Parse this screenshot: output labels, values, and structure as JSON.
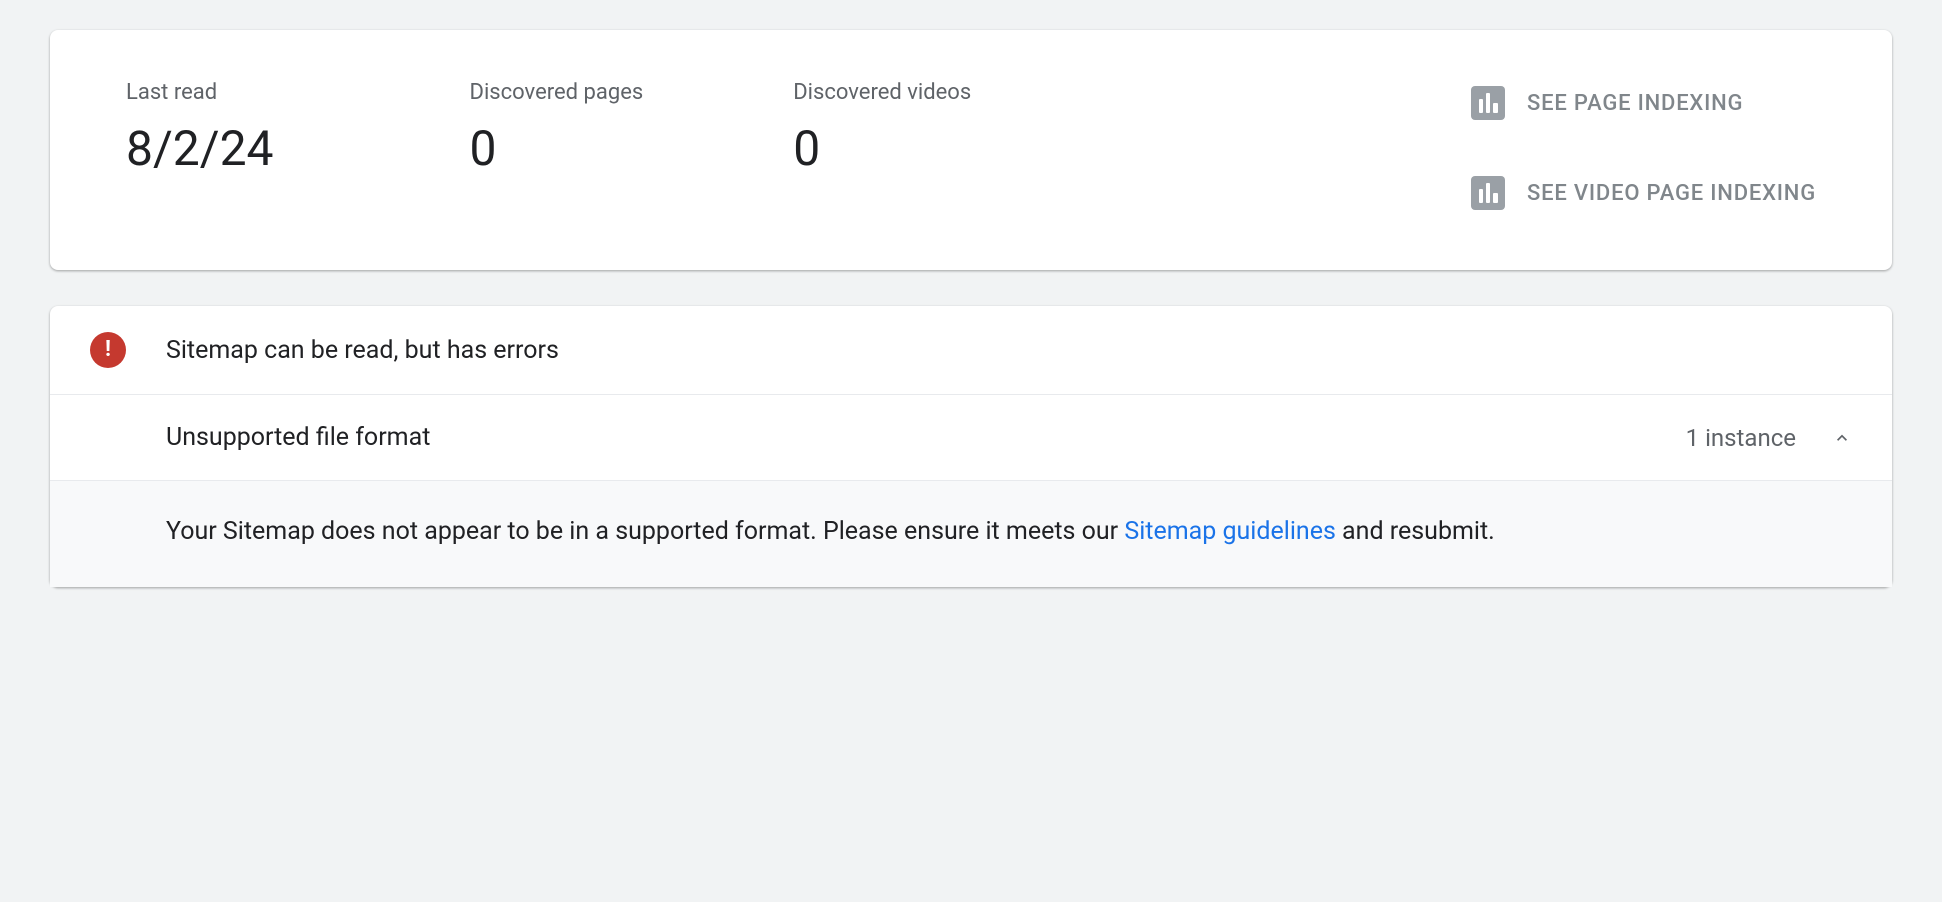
{
  "stats": {
    "last_read": {
      "label": "Last read",
      "value": "8/2/24"
    },
    "discovered_pages": {
      "label": "Discovered pages",
      "value": "0"
    },
    "discovered_videos": {
      "label": "Discovered videos",
      "value": "0"
    }
  },
  "actions": {
    "see_page_indexing": "SEE PAGE INDEXING",
    "see_video_page_indexing": "SEE VIDEO PAGE INDEXING"
  },
  "errors": {
    "header": "Sitemap can be read, but has errors",
    "items": [
      {
        "title": "Unsupported file format",
        "count_text": "1 instance",
        "detail_prefix": "Your Sitemap does not appear to be in a supported format. Please ensure it meets our ",
        "link_text": "Sitemap guidelines",
        "detail_suffix": " and resubmit."
      }
    ]
  }
}
